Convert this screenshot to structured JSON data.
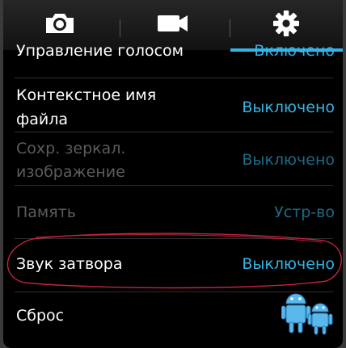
{
  "tabs": [
    {
      "icon": "camera-icon"
    },
    {
      "icon": "video-camera-icon"
    },
    {
      "icon": "gear-icon",
      "selected": true
    }
  ],
  "settings": [
    {
      "label": "Управление голосом",
      "value": "Включено",
      "enabled": true
    },
    {
      "label_lines": [
        "Контекстное имя",
        "файла"
      ],
      "value": "Выключено",
      "enabled": true
    },
    {
      "label_lines": [
        "Сохр. зеркал.",
        "изображение"
      ],
      "value": "Выключено",
      "enabled": false
    },
    {
      "label": "Память",
      "value": "Устр-во",
      "enabled": false
    },
    {
      "label": "Звук затвора",
      "value": "Выключено",
      "enabled": true,
      "highlighted": true
    },
    {
      "label": "Сброс",
      "enabled": true
    }
  ],
  "colors": {
    "accent": "#33b5e5",
    "annotation": "#c2243f",
    "disabled_text": "#5c5c5c"
  },
  "watermark": "android-robots-logo"
}
